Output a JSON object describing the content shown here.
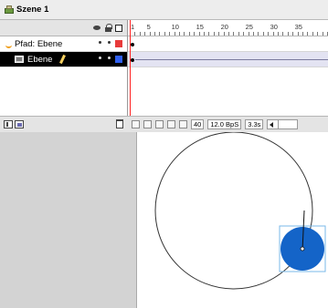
{
  "scene": {
    "title": "Szene 1"
  },
  "timeline": {
    "layers": [
      {
        "name": "Pfad: Ebene",
        "swatch_color": "#e83a3a"
      },
      {
        "name": "Ebene",
        "swatch_color": "#2f5ff0"
      }
    ],
    "ruler_labels": [
      "1",
      "5",
      "10",
      "15",
      "20",
      "25",
      "30",
      "35"
    ],
    "status": {
      "current_frame": "40",
      "frame_rate": "12.0 BpS",
      "elapsed_time": "3.3s"
    }
  },
  "stage": {
    "motion_path_color": "#333333",
    "object_color": "#1464c8",
    "selection_color": "#7ab8e8"
  }
}
